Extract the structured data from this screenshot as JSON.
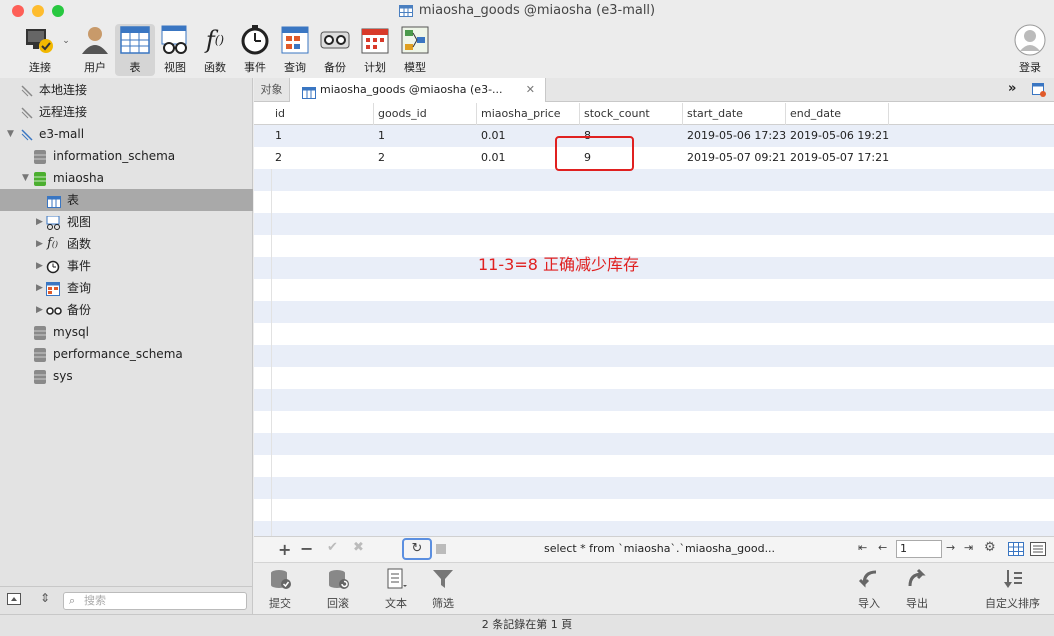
{
  "window": {
    "title": "miaosha_goods @miaosha (e3-mall)"
  },
  "toolbar": {
    "items": [
      {
        "label": "连接",
        "icon": "connection-icon"
      },
      {
        "label": "用户",
        "icon": "user-icon"
      },
      {
        "label": "表",
        "icon": "table-icon"
      },
      {
        "label": "视图",
        "icon": "view-icon"
      },
      {
        "label": "函数",
        "icon": "function-icon"
      },
      {
        "label": "事件",
        "icon": "event-icon"
      },
      {
        "label": "查询",
        "icon": "query-icon"
      },
      {
        "label": "备份",
        "icon": "backup-icon"
      },
      {
        "label": "计划",
        "icon": "schedule-icon"
      },
      {
        "label": "模型",
        "icon": "model-icon"
      }
    ],
    "login_label": "登录"
  },
  "sidebar": {
    "items": [
      {
        "label": "本地连接"
      },
      {
        "label": "远程连接"
      },
      {
        "label": "e3-mall"
      },
      {
        "label": "information_schema"
      },
      {
        "label": "miaosha"
      },
      {
        "label": "表"
      },
      {
        "label": "视图"
      },
      {
        "label": "函数"
      },
      {
        "label": "事件"
      },
      {
        "label": "查询"
      },
      {
        "label": "备份"
      },
      {
        "label": "mysql"
      },
      {
        "label": "performance_schema"
      },
      {
        "label": "sys"
      }
    ],
    "search_placeholder": "搜索"
  },
  "tabs": {
    "objects_label": "对象",
    "current_label": "miaosha_goods @miaosha (e3-..."
  },
  "table": {
    "columns": [
      "id",
      "goods_id",
      "miaosha_price",
      "stock_count",
      "start_date",
      "end_date"
    ],
    "rows": [
      [
        "1",
        "1",
        "0.01",
        "8",
        "2019-05-06 17:23",
        "2019-05-06 19:21"
      ],
      [
        "2",
        "2",
        "0.01",
        "9",
        "2019-05-07 09:21",
        "2019-05-07 17:21:"
      ]
    ]
  },
  "annotation": {
    "text": "11-3=8 正确减少库存",
    "color": "#e02020"
  },
  "bottom_bar": {
    "sql": "select * from `miaosha`.`miaosha_good...",
    "page_value": "1"
  },
  "actions": {
    "commit": "提交",
    "rollback": "回滚",
    "text": "文本",
    "filter": "筛选",
    "import": "导入",
    "export": "导出",
    "custom_sort": "自定义排序"
  },
  "status": {
    "text": "2 条記錄在第 1 頁"
  },
  "colors": {
    "accent": "#3a7bd5",
    "annotation": "#e02020"
  }
}
